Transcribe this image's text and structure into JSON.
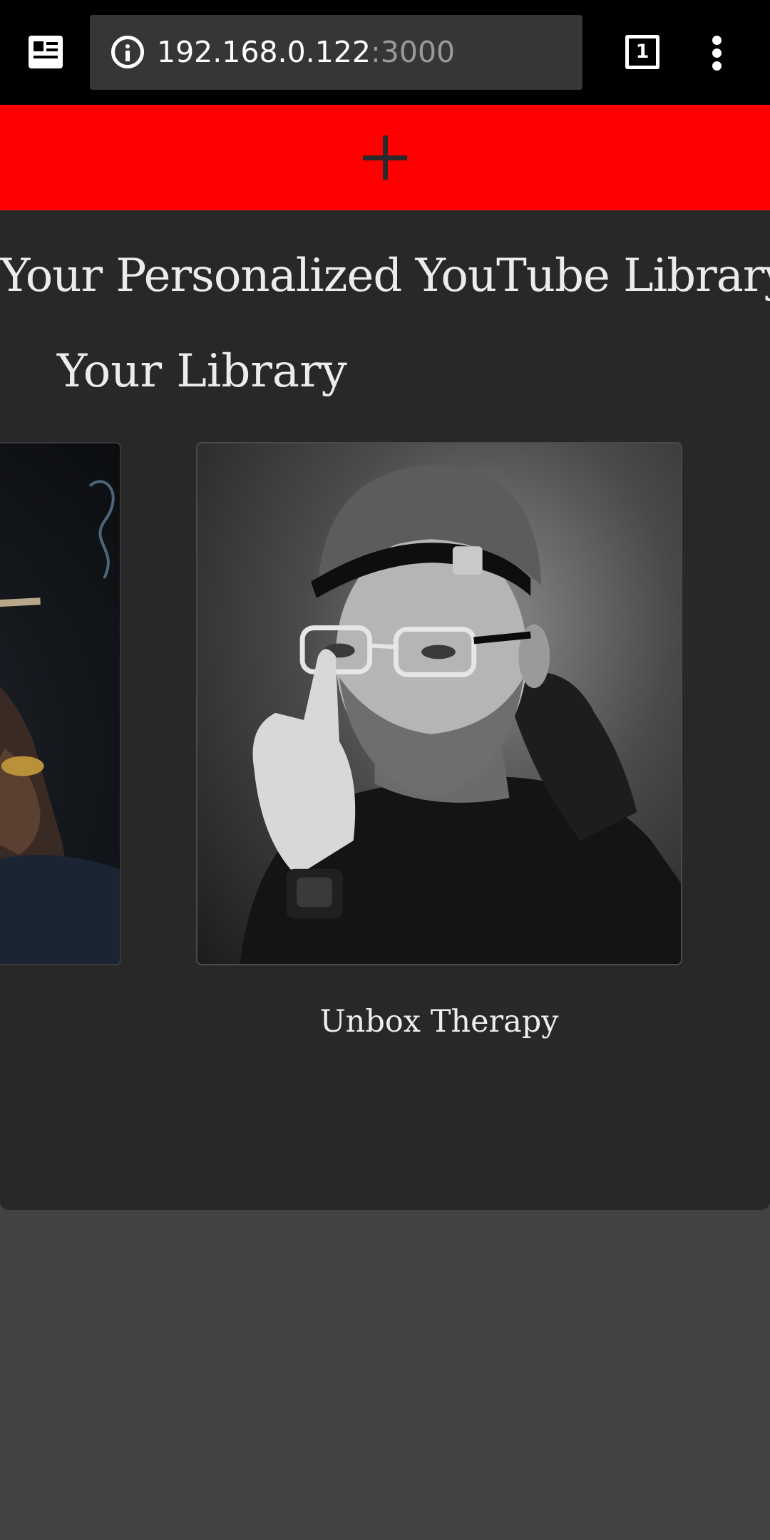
{
  "browser": {
    "url_host": "192.168.0.122",
    "url_port": ":3000",
    "tab_count": "1",
    "icons": [
      "reader-mode-icon",
      "info-icon",
      "tab-switcher-icon",
      "overflow-menu-icon"
    ]
  },
  "header": {
    "add_icon": "plus-icon",
    "colors": {
      "background": "#ff0000",
      "icon": "#2a2a2a"
    }
  },
  "main": {
    "title": "Your Personalized YouTube Library",
    "section_title": "Your Library",
    "channels": [
      {
        "name": ""
      },
      {
        "name": "Unbox Therapy"
      }
    ],
    "colors": {
      "panel": "#282828",
      "page": "#424242",
      "text": "#ececec"
    }
  }
}
